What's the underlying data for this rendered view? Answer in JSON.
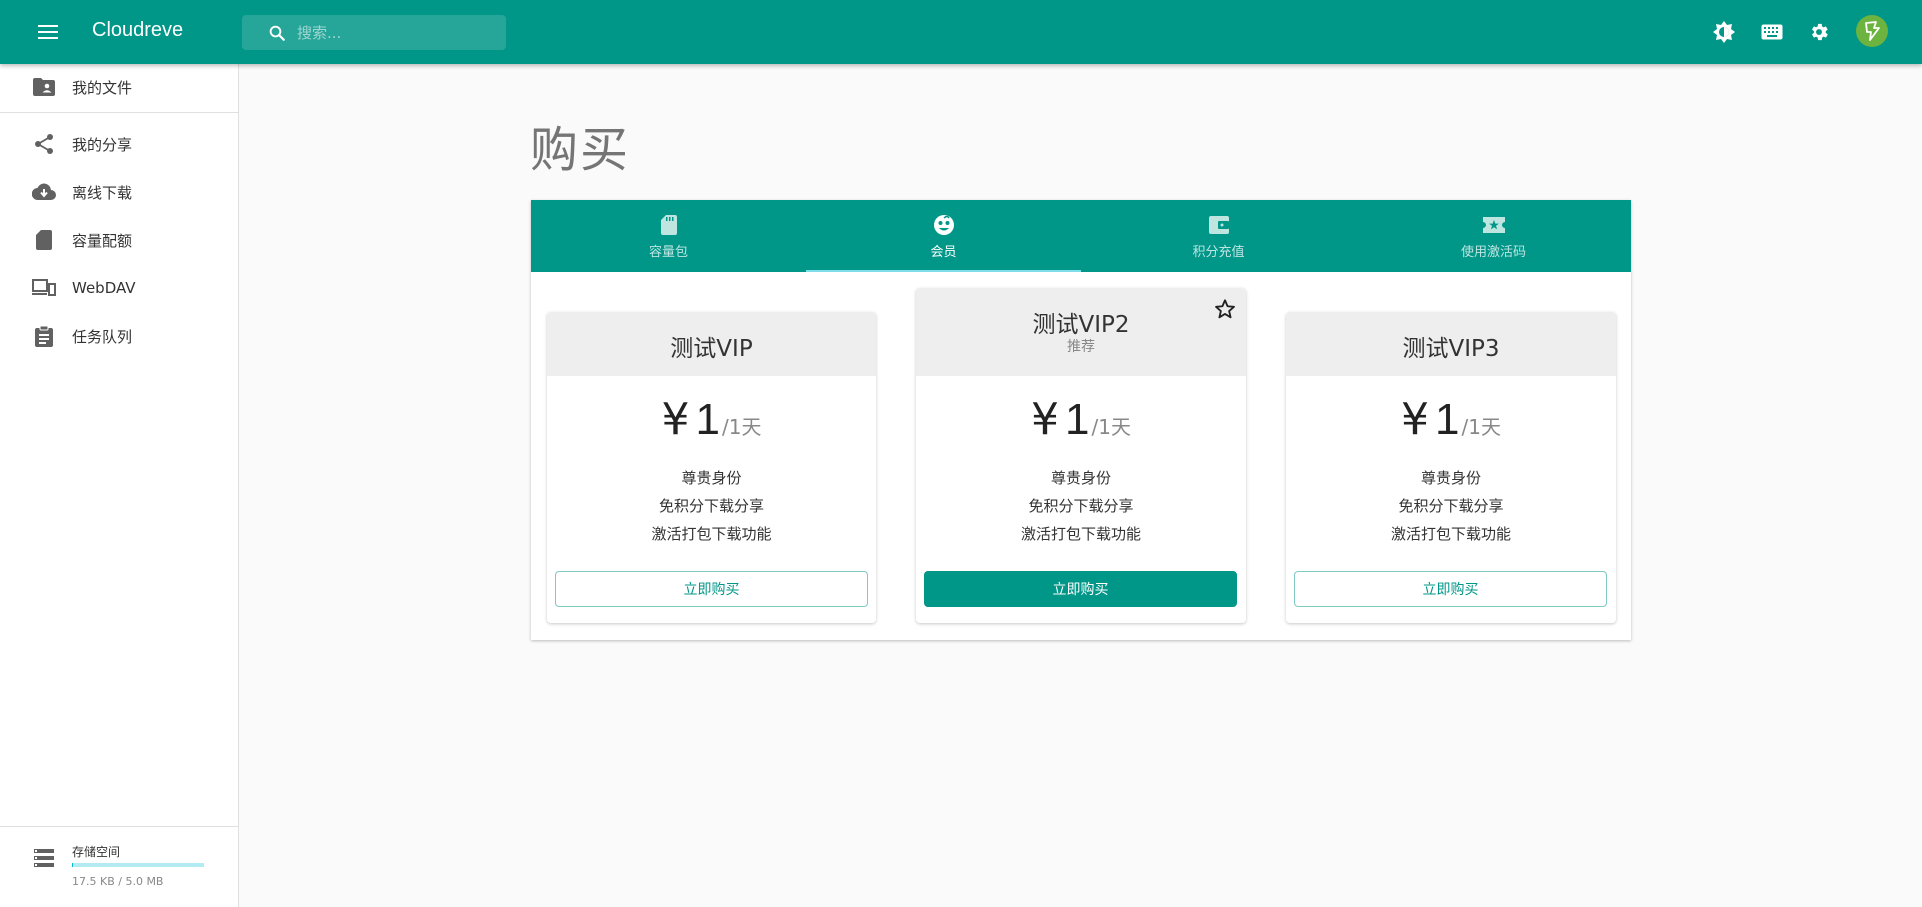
{
  "app": {
    "title": "Cloudreve",
    "search_placeholder": "搜索...",
    "accent_color": "#009688"
  },
  "header_icons": [
    "menu-icon",
    "search-icon",
    "theme-toggle-icon",
    "keyboard-icon",
    "settings-icon",
    "avatar-icon"
  ],
  "sidebar": {
    "items": [
      {
        "label": "我的文件",
        "icon": "folder-shared-icon"
      },
      {
        "label": "我的分享",
        "icon": "share-icon"
      },
      {
        "label": "离线下载",
        "icon": "cloud-download-icon"
      },
      {
        "label": "容量配额",
        "icon": "sd-card-icon"
      },
      {
        "label": "WebDAV",
        "icon": "devices-icon"
      },
      {
        "label": "任务队列",
        "icon": "assignment-icon"
      }
    ],
    "storage": {
      "title": "存储空间",
      "usage_text": "17.5 KB / 5.0 MB",
      "used_fraction": 0.0034
    }
  },
  "page": {
    "title": "购买"
  },
  "tabs": [
    {
      "label": "容量包",
      "icon": "sd-card-icon",
      "active": false
    },
    {
      "label": "会员",
      "icon": "face-icon",
      "active": true
    },
    {
      "label": "积分充值",
      "icon": "wallet-icon",
      "active": false
    },
    {
      "label": "使用激活码",
      "icon": "ticket-icon",
      "active": false
    }
  ],
  "plans": [
    {
      "name": "测试VIP",
      "subtitle": "",
      "currency": "¥",
      "price": "1",
      "unit": "/1天",
      "features": [
        "尊贵身份",
        "免积分下载分享",
        "激活打包下载功能"
      ],
      "button": "立即购买",
      "recommended": false
    },
    {
      "name": "测试VIP2",
      "subtitle": "推荐",
      "currency": "¥",
      "price": "1",
      "unit": "/1天",
      "features": [
        "尊贵身份",
        "免积分下载分享",
        "激活打包下载功能"
      ],
      "button": "立即购买",
      "recommended": true
    },
    {
      "name": "测试VIP3",
      "subtitle": "",
      "currency": "¥",
      "price": "1",
      "unit": "/1天",
      "features": [
        "尊贵身份",
        "免积分下载分享",
        "激活打包下载功能"
      ],
      "button": "立即购买",
      "recommended": false
    }
  ]
}
